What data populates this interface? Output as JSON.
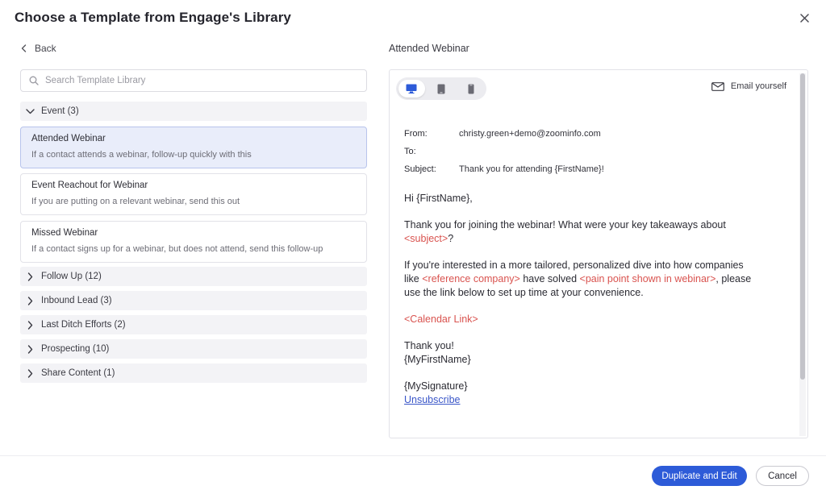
{
  "modal": {
    "title": "Choose a Template from Engage's Library"
  },
  "left": {
    "back_label": "Back",
    "search_placeholder": "Search Template Library",
    "open_category": "Event (3)",
    "templates": [
      {
        "name": "Attended Webinar",
        "desc": "If a contact attends a webinar, follow-up quickly with this"
      },
      {
        "name": "Event Reachout for Webinar",
        "desc": "If you are putting on a relevant webinar, send this out"
      },
      {
        "name": "Missed Webinar",
        "desc": "If a contact signs up for a webinar, but does not attend, send this follow-up"
      }
    ],
    "collapsed_categories": [
      "Follow Up (12)",
      "Inbound Lead (3)",
      "Last Ditch Efforts (2)",
      "Prospecting (10)",
      "Share Content (1)"
    ]
  },
  "preview": {
    "title": "Attended Webinar",
    "email_yourself": "Email yourself",
    "from_label": "From:",
    "from_value": "christy.green+demo@zoominfo.com",
    "to_label": "To:",
    "subject_label": "Subject:",
    "subject_value": "Thank you for attending {FirstName}!",
    "greeting": "Hi {FirstName},",
    "p1_a": "Thank you for joining the webinar! What were your key takeaways about",
    "p1_ph": "<subject>",
    "p1_end": "?",
    "p2_a": "If you're interested in a more tailored, personalized dive into how companies",
    "p2_b_pre": "like ",
    "p2_ph1": "<reference company>",
    "p2_b_mid": " have solved ",
    "p2_ph2": "<pain point shown in webinar>",
    "p2_b_end": ", please",
    "p2_c": "use the link below to set up time at your convenience.",
    "calendar_link": "<Calendar Link>",
    "thanks": "Thank you!",
    "my_first_name": "{MyFirstName}",
    "my_signature": "{MySignature}",
    "unsubscribe": "Unsubscribe"
  },
  "footer": {
    "primary": "Duplicate and Edit",
    "secondary": "Cancel"
  },
  "colors": {
    "accent": "#2d5bd8",
    "placeholder_red": "#d9534f",
    "selected_bg": "#e9edfa"
  }
}
